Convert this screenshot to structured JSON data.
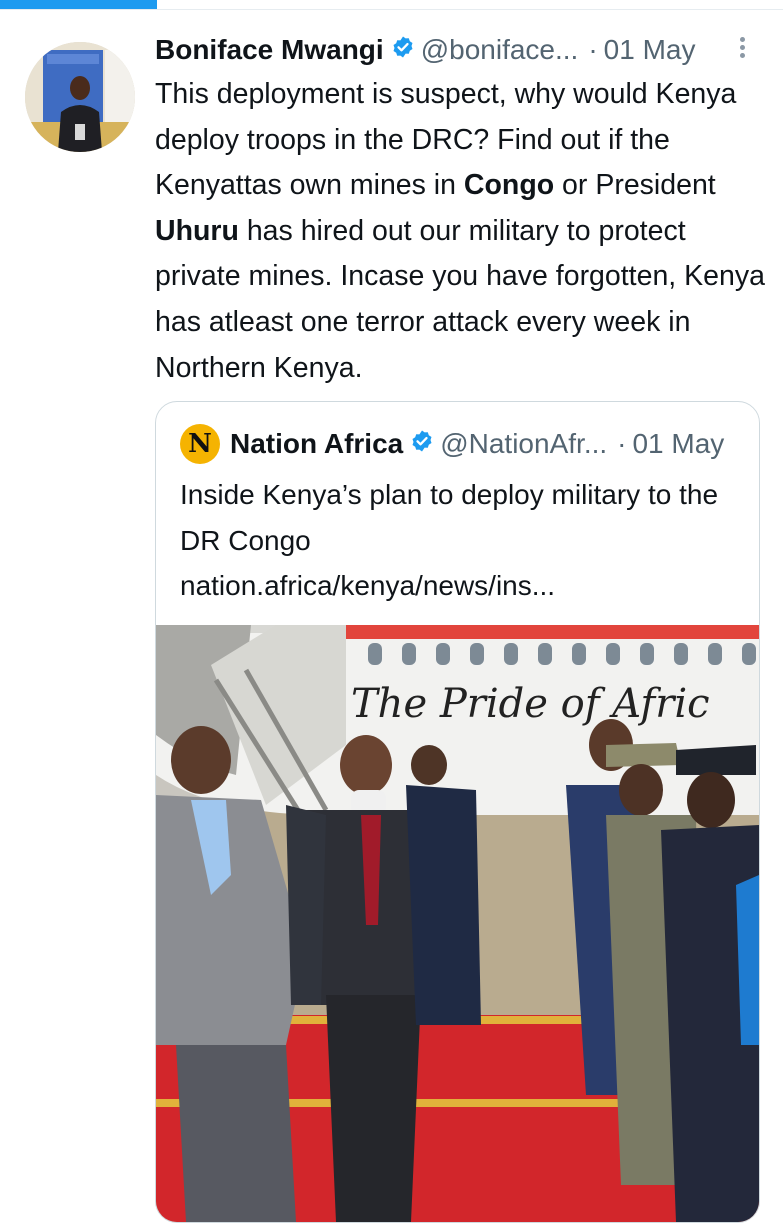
{
  "progress": {
    "fraction": 0.2
  },
  "tweet": {
    "author": {
      "name": "Boniface Mwangi",
      "handle": "@boniface...",
      "avatar_icon": "profile-photo",
      "verified": true
    },
    "separator": "·",
    "date": "01 May",
    "text": {
      "p1": "This deployment is suspect, why would Kenya deploy troops in the DRC? Find out if the Kenyattas own mines in ",
      "b1": "Congo",
      "p2": " or President ",
      "b2": "Uhuru",
      "p3": " has hired out our military to protect private mines. Incase you have forgotten, Kenya has atleast one terror attack every week in Northern Kenya."
    },
    "more_icon": "more-vertical-icon"
  },
  "quote": {
    "logo_letter": "N",
    "name": "Nation Africa",
    "handle": "@NationAfr...",
    "separator": "·",
    "date": "01 May",
    "text": "Inside Kenya’s plan to deploy military to the DR Congo",
    "link": "nation.africa/kenya/news/ins...",
    "image": {
      "description_icon": "photo-image",
      "plane_text": "The Pride of Afric"
    }
  },
  "colors": {
    "accent": "#1d9bf0",
    "verified": "#1d9bf0",
    "muted_text": "#536471",
    "border": "#cfd9de"
  }
}
